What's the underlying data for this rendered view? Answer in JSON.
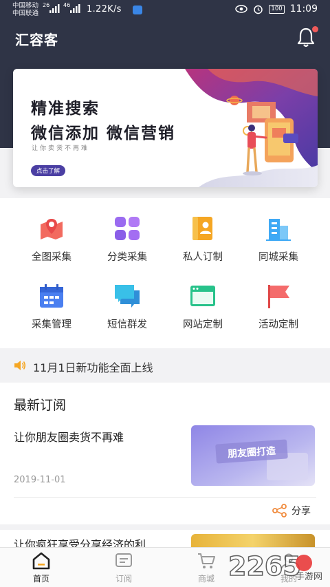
{
  "status_bar": {
    "carrier1": "中国移动",
    "carrier2": "中国联通",
    "signal1": "26",
    "signal2": "46",
    "speed": "1.22K/s",
    "battery": "100",
    "time": "11:09"
  },
  "header": {
    "title": "汇容客",
    "bell_icon": "bell-icon"
  },
  "banner": {
    "line1": "精准搜索",
    "line2": "微信添加 微信营销",
    "sub": "让你卖货不再难",
    "button": "点击了解"
  },
  "features": [
    {
      "label": "全图采集",
      "icon": "map-pin-icon"
    },
    {
      "label": "分类采集",
      "icon": "grid-icon"
    },
    {
      "label": "私人订制",
      "icon": "contact-book-icon"
    },
    {
      "label": "同城采集",
      "icon": "city-buildings-icon"
    },
    {
      "label": "采集管理",
      "icon": "calendar-icon"
    },
    {
      "label": "短信群发",
      "icon": "chat-bubbles-icon"
    },
    {
      "label": "网站定制",
      "icon": "browser-window-icon"
    },
    {
      "label": "活动定制",
      "icon": "flag-icon"
    }
  ],
  "notice": {
    "text": "11月1日新功能全面上线"
  },
  "feed": {
    "title": "最新订阅",
    "articles": [
      {
        "title": "让你朋友圈卖货不再难",
        "date": "2019-11-01",
        "thumb_text": "朋友圈打造"
      },
      {
        "title": "让你疯狂享受分享经济的利"
      }
    ],
    "share_label": "分享"
  },
  "tabs": [
    {
      "label": "首页",
      "icon": "home-icon",
      "active": true
    },
    {
      "label": "订阅",
      "icon": "subscribe-icon",
      "active": false
    },
    {
      "label": "商城",
      "icon": "cart-icon",
      "active": false
    },
    {
      "label": "我的",
      "icon": "user-icon",
      "active": false
    }
  ],
  "watermark": {
    "brand": "2265",
    "site": "手游网"
  },
  "colors": {
    "header_bg": "#2f3446",
    "accent": "#4b3fa3",
    "active_tab": "#222222",
    "inactive_tab": "#999999"
  }
}
